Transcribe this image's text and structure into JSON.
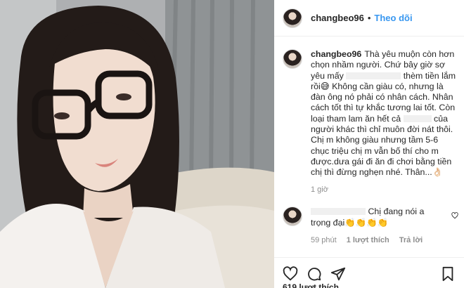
{
  "post": {
    "username": "changbeo96",
    "separator": "•",
    "follow_label": "Theo dõi"
  },
  "caption": {
    "username": "changbeo96",
    "line1": "Thà yêu muộn còn hơn chọn nhầm người. Chứ bây giờ sợ yêu mấy",
    "line2": "thèm tiền lắm rồi😅 Không cần giàu có, nhưng là đàn ông nó phải có nhân cách. Nhân cách tốt thì tự khắc tương lai tốt. Còn loại tham lam ăn hết cả",
    "line3": "của người khác thì chỉ muôn đời nát thôi. Chị m không giàu nhưng tầm 5-6 chục triệu chị m vẫn bố thí cho m được.dưa gái đi ăn đi chơi bằng tiền chị thì đừng nghẹn nhé. Thân...👌🏻",
    "time": "1 giờ"
  },
  "comment": {
    "text": "Chị đang nói a trọng đại👏👏👏👏",
    "time": "59 phút",
    "likes_label": "1 lượt thích",
    "reply_label": "Trả lời"
  },
  "actions": {
    "icons": [
      "heart-icon",
      "comment-icon",
      "share-icon",
      "bookmark-icon"
    ],
    "likes_count": "619 lượt thích"
  },
  "colors": {
    "link_blue": "#3897f0",
    "muted": "#8e8e8e",
    "text": "#262626",
    "border": "#efefef"
  }
}
